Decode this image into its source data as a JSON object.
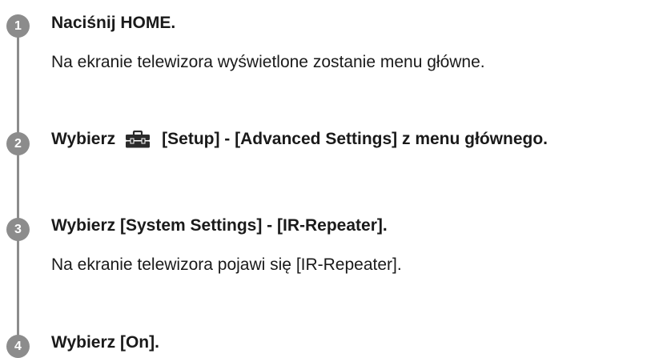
{
  "steps": [
    {
      "number": "1",
      "title": "Naciśnij HOME.",
      "description": "Na ekranie telewizora wyświetlone zostanie menu główne."
    },
    {
      "number": "2",
      "title_before_icon": "Wybierz",
      "icon": "toolbox-icon",
      "title_after_icon": "[Setup] - [Advanced Settings] z menu głównego."
    },
    {
      "number": "3",
      "title": "Wybierz [System Settings] - [IR-Repeater].",
      "description": "Na ekranie telewizora pojawi się [IR-Repeater]."
    },
    {
      "number": "4",
      "title": "Wybierz [On]."
    }
  ],
  "colors": {
    "marker": "#8c8c8c",
    "text": "#1a1a1a",
    "icon": "#2b2b2b"
  }
}
